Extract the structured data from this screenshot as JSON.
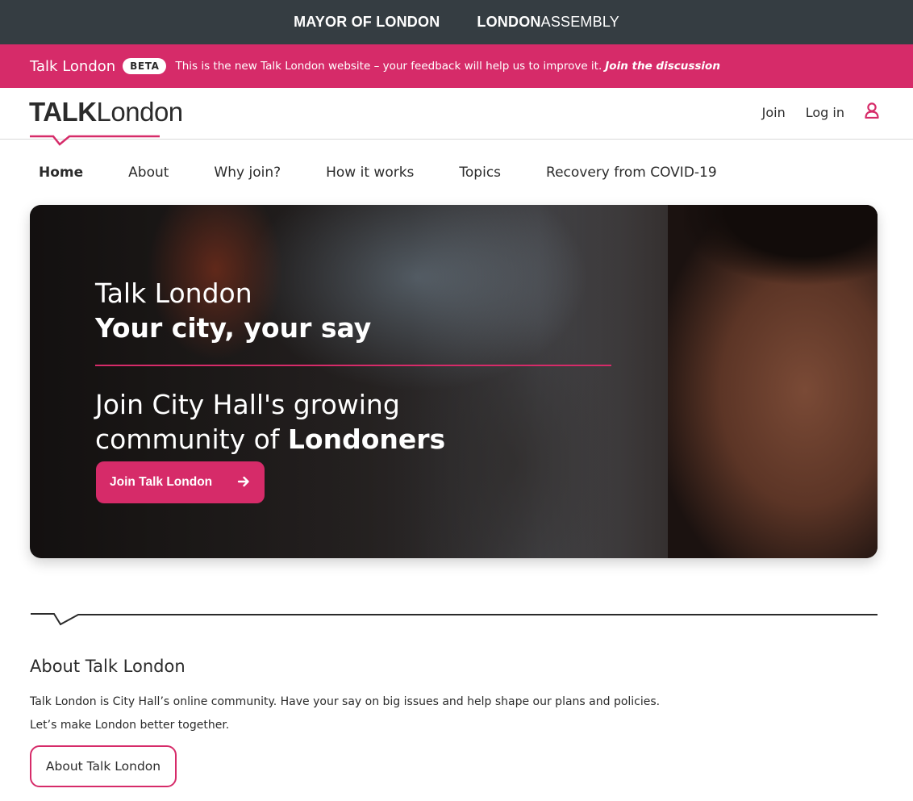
{
  "gla_bar": {
    "mayor": "MAYOR OF LONDON",
    "assembly_bold": "LONDON",
    "assembly_rest": "ASSEMBLY"
  },
  "beta_bar": {
    "site_name": "Talk London",
    "badge": "BETA",
    "message": "This is the new Talk London website – your feedback will help us to improve it.",
    "link": "Join the discussion"
  },
  "header": {
    "logo_bold": "TALK",
    "logo_rest": "London",
    "join": "Join",
    "login": "Log in"
  },
  "nav": {
    "items": [
      {
        "label": "Home",
        "active": true
      },
      {
        "label": "About"
      },
      {
        "label": "Why join?"
      },
      {
        "label": "How it works"
      },
      {
        "label": "Topics"
      },
      {
        "label": "Recovery from COVID-19"
      }
    ]
  },
  "hero": {
    "title": "Talk London",
    "subtitle": "Your city, your say",
    "join_line1": "Join City Hall's growing",
    "join_line2_prefix": "community of ",
    "join_line2_bold": "Londoners",
    "button": "Join Talk London"
  },
  "about": {
    "heading": "About Talk London",
    "p1": "Talk London is City Hall’s online community. Have your say on big issues and help shape our plans and policies.",
    "p2": "Let’s make London better together.",
    "button": "About Talk London"
  },
  "colors": {
    "brand_pink": "#d62b69",
    "gla_dark": "#353d42",
    "text": "#2b2b2b"
  },
  "icons": {
    "user": "user-icon",
    "arrow": "arrow-right-icon",
    "divider": "speech-divider-icon"
  }
}
